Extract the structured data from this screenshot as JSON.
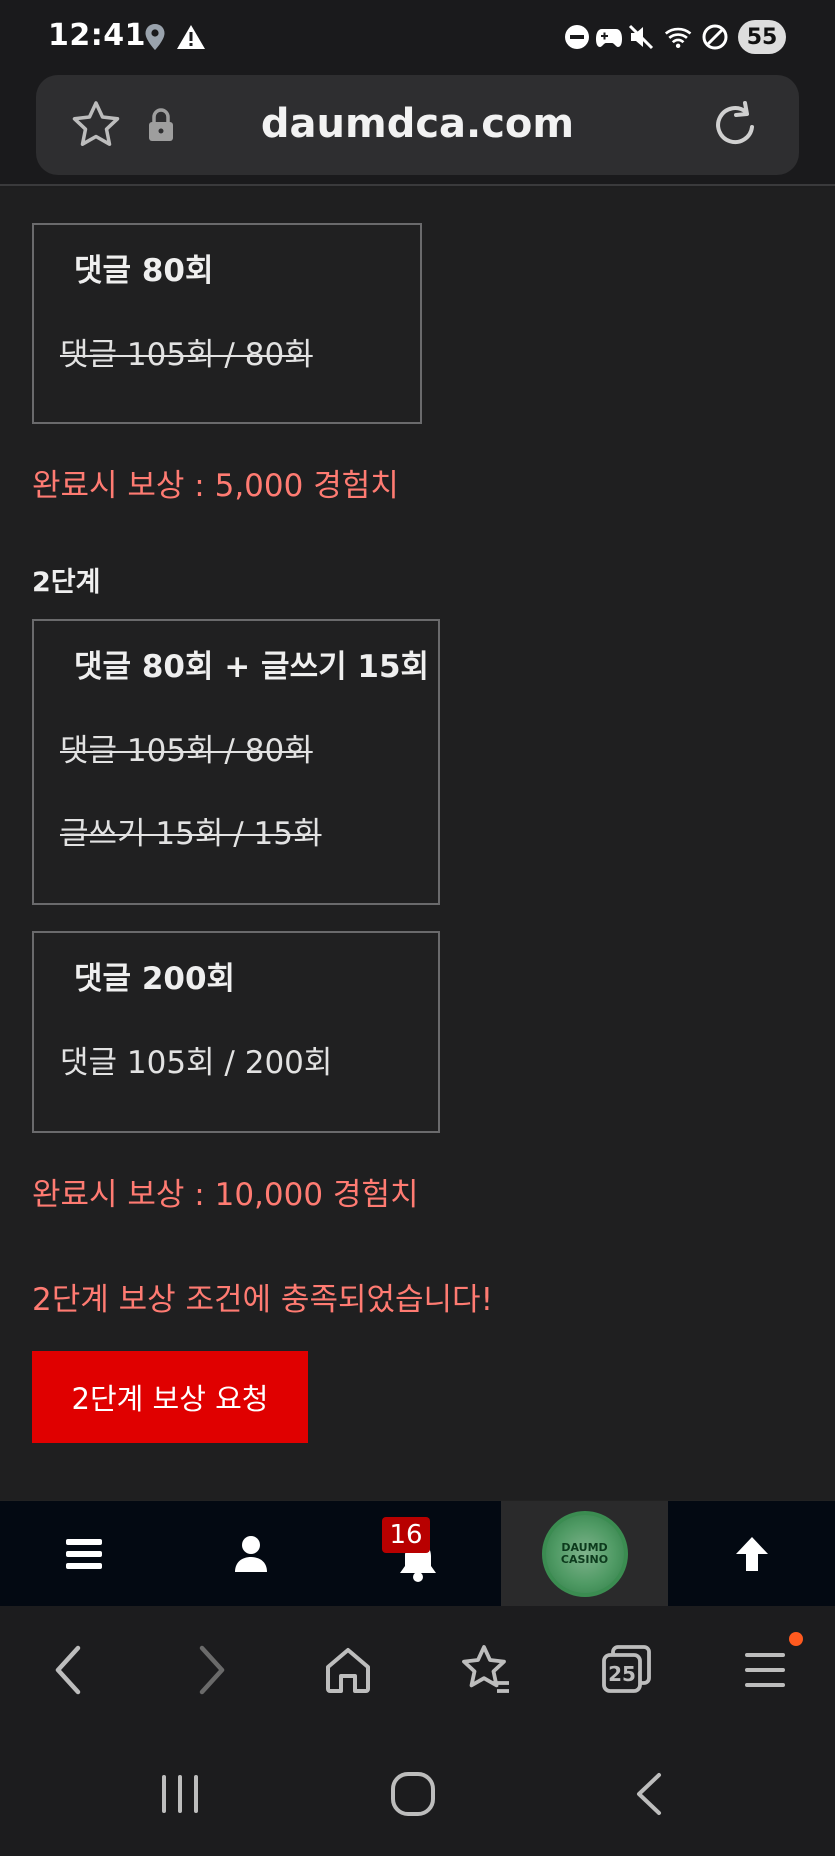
{
  "status_bar": {
    "time": "12:41",
    "battery": "55",
    "icons": [
      "location-icon",
      "alert-icon",
      "dnd-icon",
      "game-icon",
      "mute-icon",
      "wifi-icon",
      "block-icon"
    ]
  },
  "url_bar": {
    "url": "daumdca.com"
  },
  "missions": {
    "stage1_box": {
      "title": "댓글 80회",
      "lines": [
        "댓글 105회 / 80회"
      ]
    },
    "stage1_reward": "완료시 보상 : 5,000 경험치",
    "stage2_label": "2단계",
    "stage2_box1": {
      "title": "댓글 80회 + 글쓰기 15회",
      "lines": [
        "댓글 105회 / 80회",
        "글쓰기 15회 / 15회"
      ]
    },
    "stage2_box2": {
      "title": "댓글 200회",
      "lines": [
        "댓글 105회 / 200회"
      ]
    },
    "stage2_reward": "완료시 보상 : 10,000 경험치",
    "stage2_notice": "2단계 보상 조건에 충족되었습니다!",
    "request_button": "2단계 보상 요청"
  },
  "site_nav": {
    "notification_count": "16",
    "logo_line1": "DAUMD",
    "logo_line2": "CASINO"
  },
  "browser_toolbar": {
    "tabs_count": "25"
  },
  "colors": {
    "background": "#1f1f20",
    "reward_text": "#ff7b72",
    "request_button": "#e00000",
    "site_nav_bg": "#030912",
    "badge_bg": "#b80000"
  }
}
